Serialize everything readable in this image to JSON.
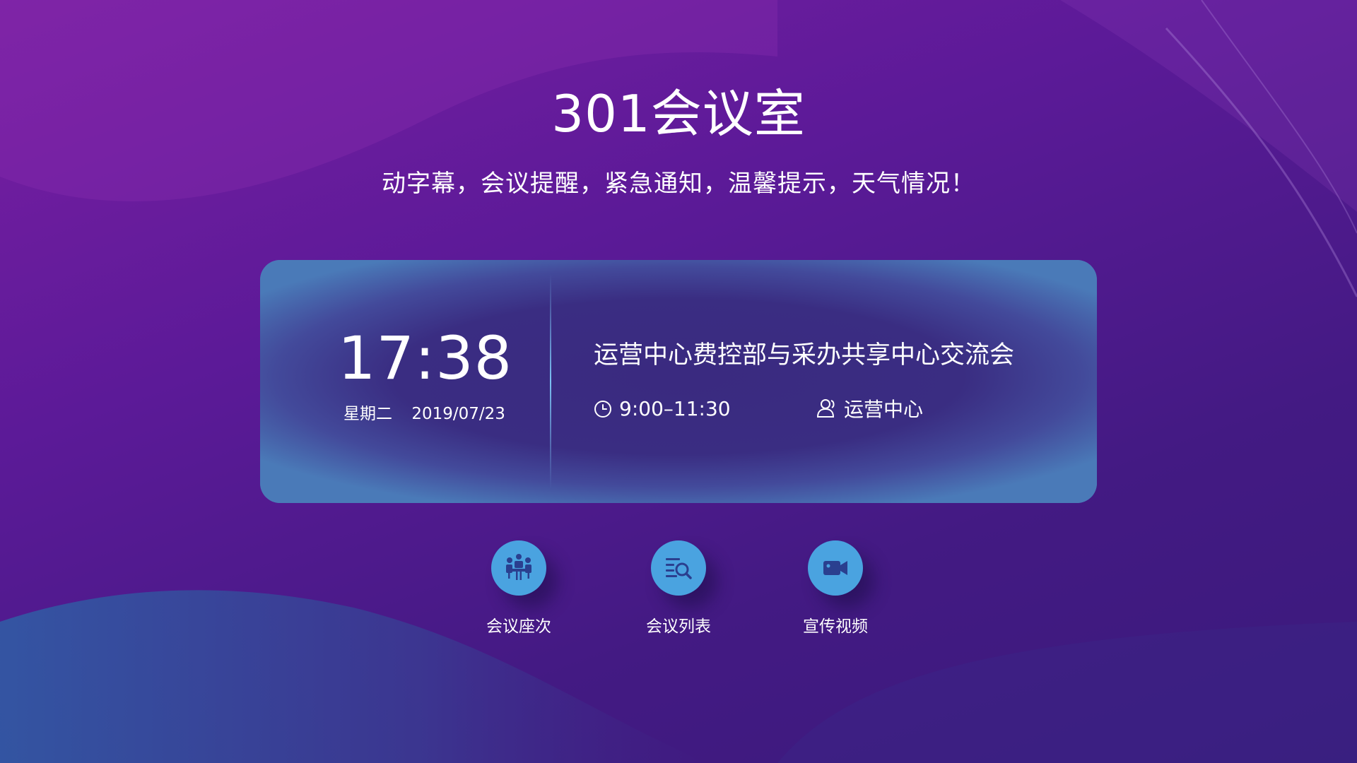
{
  "room": {
    "title": "301会议室",
    "subtitle": "动字幕，会议提醒，紧急通知，温馨提示，天气情况！"
  },
  "clock": {
    "time": "17:38",
    "weekday": "星期二",
    "date": "2019/07/23"
  },
  "meeting": {
    "title": "运营中心费控部与采办共享中心交流会",
    "time_range": "9:00–11:30",
    "host": "运营中心",
    "time_icon": "clock-icon",
    "host_icon": "users-icon"
  },
  "actions": [
    {
      "label": "会议座次",
      "icon": "meeting-seating-icon"
    },
    {
      "label": "会议列表",
      "icon": "meeting-list-icon"
    },
    {
      "label": "宣传视频",
      "icon": "video-camera-icon"
    }
  ],
  "colors": {
    "background_start": "#7a1fa3",
    "background_end": "#3a1a7c",
    "card_border": "#4a7ab8",
    "card_center": "#3a2a80",
    "action_button": "#4aa3e0",
    "icon_dark": "#2a3f8f"
  }
}
